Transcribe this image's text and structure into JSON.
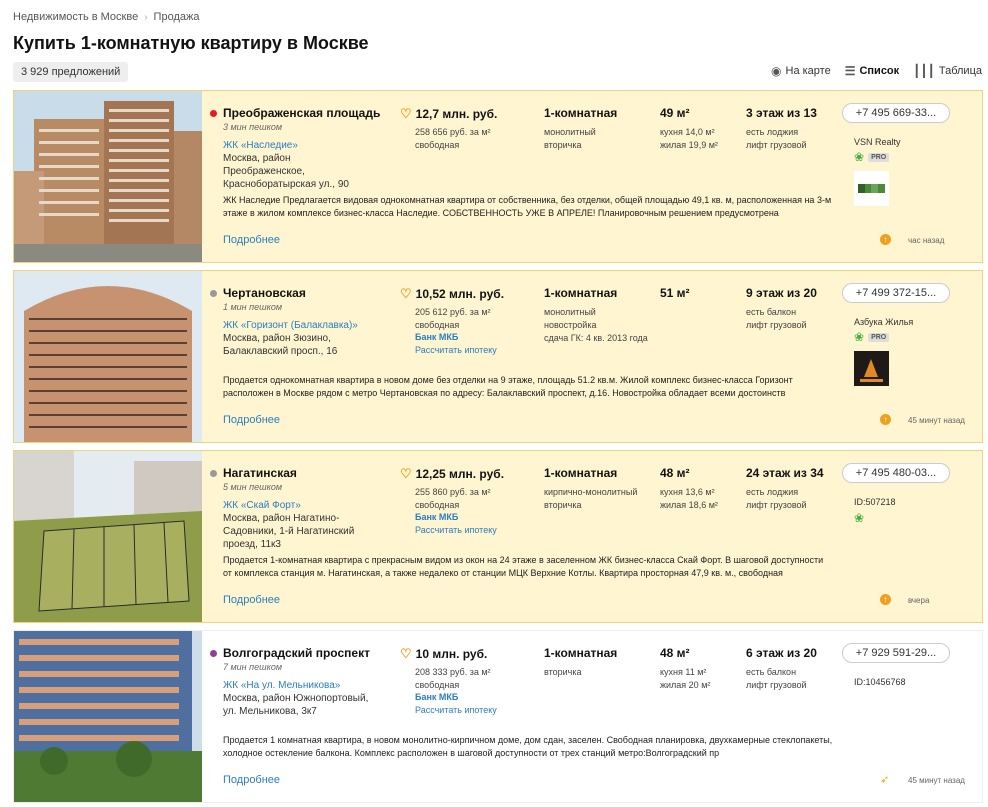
{
  "breadcrumbs": [
    "Недвижимость в Москве",
    "Продажа"
  ],
  "title": "Купить 1-комнатную квартиру в Москве",
  "count": "3 929 предложений",
  "view": {
    "map": "На карте",
    "list": "Список",
    "table": "Таблица"
  },
  "colors": {
    "accent": "#2a7ec2",
    "highlight_bg": "#fff5d0",
    "highlight_border": "#f2d37a"
  },
  "listings": [
    {
      "metro": "Преображенская площадь",
      "metro_color": "#e21b24",
      "walk": "3 мин пешком",
      "jk": "ЖК «Наследие»",
      "address": "Москва, район Преображенское, Красноборатырская ул., 90",
      "price": "12,7 млн. руб.",
      "ppm": "258 656 руб. за м²",
      "sale": "свободная",
      "bank": "",
      "mortgage": "",
      "rooms": "1-комнатная",
      "type": "монолитный",
      "type2": "вторичка",
      "area": "49 м²",
      "kitchen": "кухня 14,0 м²",
      "living": "жилая 19,9 м²",
      "floor": "3 этаж из 13",
      "floor1": "есть лоджия",
      "floor2": "лифт грузовой",
      "desc": "ЖК Наследие Предлагается видовая однокомнатная квартира от собственника, без отделки, общей площадью 49,1 кв. м, расположенная на 3-м этаже в жилом комплексе бизнес-класса Наследие. СОБСТВЕННОСТЬ УЖЕ В АПРЕЛЕ! Планировочным решением предусмотрена",
      "more": "Подробнее",
      "phone": "+7 495 669-33...",
      "agent": "VSN Realty",
      "pro": "PRO",
      "id": "",
      "time": "час назад",
      "highlight": true
    },
    {
      "metro": "Чертановская",
      "metro_color": "#999999",
      "walk": "1 мин пешком",
      "jk": "ЖК «Горизонт (Балаклавка)»",
      "address": "Москва, район Зюзино, Балаклавский просп., 16",
      "price": "10,52 млн. руб.",
      "ppm": "205 612 руб. за м²",
      "sale": "свободная",
      "bank": "Банк МКБ",
      "mortgage": "Рассчитать ипотеку",
      "rooms": "1-комнатная",
      "type": "монолитный",
      "type2": "новостройка",
      "type3": "сдача ГК: 4 кв. 2013 года",
      "area": "51 м²",
      "kitchen": "",
      "living": "",
      "floor": "9 этаж из 20",
      "floor1": "есть балкон",
      "floor2": "лифт грузовой",
      "desc": "Продается однокомнатная квартира в новом доме без отделки на 9 этаже, площадь 51.2 кв.м. Жилой комплекс бизнес-класса Горизонт расположен в Москве рядом с метро Чертановская по адресу: Балаклавский проспект, д.16. Новостройка обладает всеми достоинств",
      "more": "Подробнее",
      "phone": "+7 499 372-15...",
      "agent": "Азбука Жилья",
      "pro": "PRO",
      "id": "",
      "time": "45 минут назад",
      "highlight": true
    },
    {
      "metro": "Нагатинская",
      "metro_color": "#999999",
      "walk": "5 мин пешком",
      "jk": "ЖК «Скай Форт»",
      "address": "Москва, район Нагатино-Садовники, 1-й Нагатинский проезд, 11к3",
      "price": "12,25 млн. руб.",
      "ppm": "255 860 руб. за м²",
      "sale": "свободная",
      "bank": "Банк МКБ",
      "mortgage": "Рассчитать ипотеку",
      "rooms": "1-комнатная",
      "type": "кирпично-монолитный",
      "type2": "вторичка",
      "area": "48 м²",
      "kitchen": "кухня 13,6 м²",
      "living": "жилая 18,6 м²",
      "floor": "24 этаж из 34",
      "floor1": "есть лоджия",
      "floor2": "лифт грузовой",
      "desc": "Продается 1-комнатная квартира с прекрасным видом из окон на 24 этаже в заселенном ЖК бизнес-класса Скай Форт. В шаговой доступности от комплекса станция м. Нагатинская, а также недалеко от станции МЦК Верхние Котлы. Квартира просторная 47,9 кв. м., свободная",
      "more": "Подробнее",
      "phone": "+7 495 480-03...",
      "agent": "",
      "pro": "",
      "id": "ID:507218",
      "time": "вчера",
      "highlight": true
    },
    {
      "metro": "Волгоградский проспект",
      "metro_color": "#943e90",
      "walk": "7 мин пешком",
      "jk": "ЖК «На ул. Мельникова»",
      "address": "Москва, район Южнопортовый, ул. Мельникова, 3к7",
      "price": "10 млн. руб.",
      "ppm": "208 333 руб. за м²",
      "sale": "свободная",
      "bank": "Банк МКБ",
      "mortgage": "Рассчитать ипотеку",
      "rooms": "1-комнатная",
      "type": "вторичка",
      "type2": "",
      "area": "48 м²",
      "kitchen": "кухня 11 м²",
      "living": "жилая 20 м²",
      "floor": "6 этаж из 20",
      "floor1": "есть балкон",
      "floor2": "лифт грузовой",
      "desc": "Продается 1 комнатная квартира, в новом монолитно-кирпичном доме, дом сдан, заселен. Свободная планировка, двухкамерные стеклопакеты, холодное остекление балкона. Комплекс расположен в шаговой доступности от трех станций метро:Волгоградский пр",
      "more": "Подробнее",
      "phone": "+7 929 591-29...",
      "agent": "",
      "pro": "",
      "id": "ID:10456768",
      "time": "45 минут назад",
      "highlight": false
    }
  ]
}
